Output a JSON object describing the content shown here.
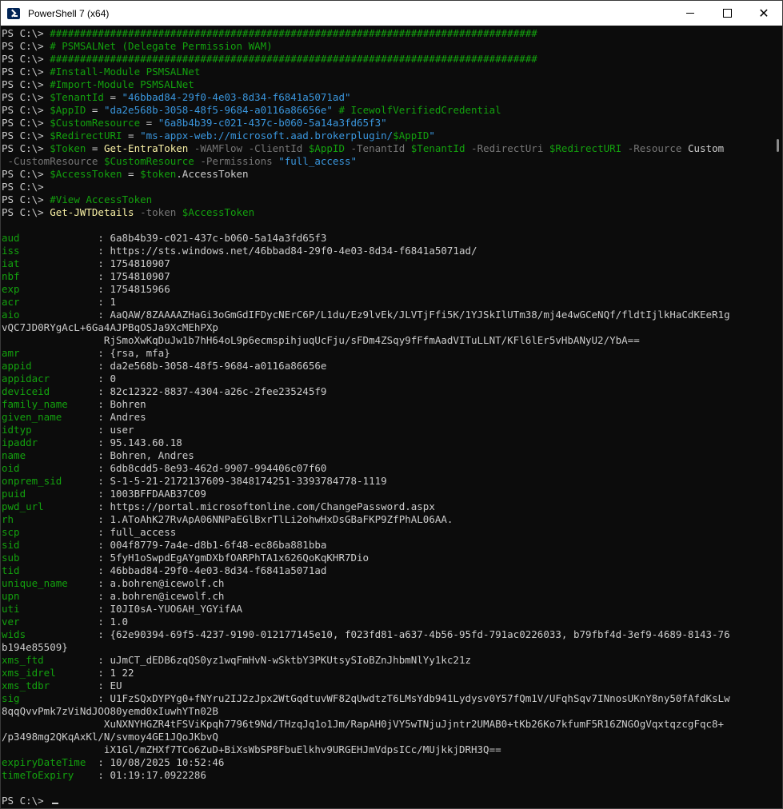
{
  "window": {
    "title": "PowerShell 7 (x64)",
    "minimize_label": "minimize",
    "maximize_label": "maximize",
    "close_label": "close"
  },
  "colors": {
    "background": "#0c0c0c",
    "comment": "#13a10e",
    "string": "#3a96dd",
    "command": "#f9f1a5",
    "parameter": "#767676",
    "key": "#13a10e",
    "text": "#cccccc"
  },
  "console": {
    "lines": [
      [
        {
          "t": "p",
          "x": "PS C:\\> "
        },
        {
          "t": "c",
          "x": "#################################################################################"
        }
      ],
      [
        {
          "t": "p",
          "x": "PS C:\\> "
        },
        {
          "t": "c",
          "x": "# PSMSALNet (Delegate Permission WAM)"
        }
      ],
      [
        {
          "t": "p",
          "x": "PS C:\\> "
        },
        {
          "t": "c",
          "x": "#################################################################################"
        }
      ],
      [
        {
          "t": "p",
          "x": "PS C:\\> "
        },
        {
          "t": "c",
          "x": "#Install-Module PSMSALNet"
        }
      ],
      [
        {
          "t": "p",
          "x": "PS C:\\> "
        },
        {
          "t": "c",
          "x": "#Import-Module PSMSALNet"
        }
      ],
      [
        {
          "t": "p",
          "x": "PS C:\\> "
        },
        {
          "t": "v",
          "x": "$TenantId"
        },
        {
          "t": "t",
          "x": " = "
        },
        {
          "t": "s",
          "x": "\"46bbad84-29f0-4e03-8d34-f6841a5071ad\""
        }
      ],
      [
        {
          "t": "p",
          "x": "PS C:\\> "
        },
        {
          "t": "v",
          "x": "$AppID"
        },
        {
          "t": "t",
          "x": " = "
        },
        {
          "t": "s",
          "x": "\"da2e568b-3058-48f5-9684-a0116a86656e\""
        },
        {
          "t": "t",
          "x": " "
        },
        {
          "t": "c",
          "x": "# IcewolfVerifiedCredential"
        }
      ],
      [
        {
          "t": "p",
          "x": "PS C:\\> "
        },
        {
          "t": "v",
          "x": "$CustomResource"
        },
        {
          "t": "t",
          "x": " = "
        },
        {
          "t": "s",
          "x": "\"6a8b4b39-c021-437c-b060-5a14a3fd65f3\""
        }
      ],
      [
        {
          "t": "p",
          "x": "PS C:\\> "
        },
        {
          "t": "v",
          "x": "$RedirectURI"
        },
        {
          "t": "t",
          "x": " = "
        },
        {
          "t": "s",
          "x": "\"ms-appx-web://microsoft.aad.brokerplugin/"
        },
        {
          "t": "v",
          "x": "$AppID"
        },
        {
          "t": "s",
          "x": "\""
        }
      ],
      [
        {
          "t": "p",
          "x": "PS C:\\> "
        },
        {
          "t": "v",
          "x": "$Token"
        },
        {
          "t": "t",
          "x": " = "
        },
        {
          "t": "cmd",
          "x": "Get-EntraToken"
        },
        {
          "t": "prm",
          "x": " -WAMFlow -ClientId "
        },
        {
          "t": "v",
          "x": "$AppID"
        },
        {
          "t": "prm",
          "x": " -TenantId "
        },
        {
          "t": "v",
          "x": "$TenantId"
        },
        {
          "t": "prm",
          "x": " -RedirectUri "
        },
        {
          "t": "v",
          "x": "$RedirectURI"
        },
        {
          "t": "prm",
          "x": " -Resource "
        },
        {
          "t": "t",
          "x": "Custom"
        }
      ],
      [
        {
          "t": "prm",
          "x": " -CustomResource "
        },
        {
          "t": "v",
          "x": "$CustomResource"
        },
        {
          "t": "prm",
          "x": " -Permissions "
        },
        {
          "t": "s",
          "x": "\"full_access\""
        }
      ],
      [
        {
          "t": "p",
          "x": "PS C:\\> "
        },
        {
          "t": "v",
          "x": "$AccessToken"
        },
        {
          "t": "t",
          "x": " = "
        },
        {
          "t": "v",
          "x": "$token"
        },
        {
          "t": "t",
          "x": ".AccessToken"
        }
      ],
      [
        {
          "t": "p",
          "x": "PS C:\\> "
        }
      ],
      [
        {
          "t": "p",
          "x": "PS C:\\> "
        },
        {
          "t": "c",
          "x": "#View AccessToken"
        }
      ],
      [
        {
          "t": "p",
          "x": "PS C:\\> "
        },
        {
          "t": "cmd",
          "x": "Get-JWTDetails"
        },
        {
          "t": "prm",
          "x": " -token "
        },
        {
          "t": "v",
          "x": "$AccessToken"
        }
      ],
      [],
      [
        {
          "t": "k",
          "x": "aud            "
        },
        {
          "t": "val",
          "x": " : 6a8b4b39-c021-437c-b060-5a14a3fd65f3"
        }
      ],
      [
        {
          "t": "k",
          "x": "iss            "
        },
        {
          "t": "val",
          "x": " : https://sts.windows.net/46bbad84-29f0-4e03-8d34-f6841a5071ad/"
        }
      ],
      [
        {
          "t": "k",
          "x": "iat            "
        },
        {
          "t": "val",
          "x": " : 1754810907"
        }
      ],
      [
        {
          "t": "k",
          "x": "nbf            "
        },
        {
          "t": "val",
          "x": " : 1754810907"
        }
      ],
      [
        {
          "t": "k",
          "x": "exp            "
        },
        {
          "t": "val",
          "x": " : 1754815966"
        }
      ],
      [
        {
          "t": "k",
          "x": "acr            "
        },
        {
          "t": "val",
          "x": " : 1"
        }
      ],
      [
        {
          "t": "k",
          "x": "aio            "
        },
        {
          "t": "val",
          "x": " : AaQAW/8ZAAAAZHaGi3oGmGdIFDycNErC6P/L1du/Ez9lvEk/JLVTjFfi5K/1YJSkIlUTm38/mj4e4wGCeNQf/fldtIjlkHaCdKEeR1g"
        }
      ],
      [
        {
          "t": "val",
          "x": "vQC7JD0RYgAcL+6Ga4AJPBqOSJa9XcMEhPXp"
        }
      ],
      [
        {
          "t": "val",
          "x": "                 RjSmoXwKqDuJw1b7hH64oL9p6ecmspihjuqUcFju/sFDm4ZSqy9fFfmAadVITuLLNT/KFl6lEr5vHbANyU2/YbA=="
        }
      ],
      [
        {
          "t": "k",
          "x": "amr            "
        },
        {
          "t": "val",
          "x": " : {rsa, mfa}"
        }
      ],
      [
        {
          "t": "k",
          "x": "appid          "
        },
        {
          "t": "val",
          "x": " : da2e568b-3058-48f5-9684-a0116a86656e"
        }
      ],
      [
        {
          "t": "k",
          "x": "appidacr       "
        },
        {
          "t": "val",
          "x": " : 0"
        }
      ],
      [
        {
          "t": "k",
          "x": "deviceid       "
        },
        {
          "t": "val",
          "x": " : 82c12322-8837-4304-a26c-2fee235245f9"
        }
      ],
      [
        {
          "t": "k",
          "x": "family_name    "
        },
        {
          "t": "val",
          "x": " : Bohren"
        }
      ],
      [
        {
          "t": "k",
          "x": "given_name     "
        },
        {
          "t": "val",
          "x": " : Andres"
        }
      ],
      [
        {
          "t": "k",
          "x": "idtyp          "
        },
        {
          "t": "val",
          "x": " : user"
        }
      ],
      [
        {
          "t": "k",
          "x": "ipaddr         "
        },
        {
          "t": "val",
          "x": " : 95.143.60.18"
        }
      ],
      [
        {
          "t": "k",
          "x": "name           "
        },
        {
          "t": "val",
          "x": " : Bohren, Andres"
        }
      ],
      [
        {
          "t": "k",
          "x": "oid            "
        },
        {
          "t": "val",
          "x": " : 6db8cdd5-8e93-462d-9907-994406c07f60"
        }
      ],
      [
        {
          "t": "k",
          "x": "onprem_sid     "
        },
        {
          "t": "val",
          "x": " : S-1-5-21-2172137609-3848174251-3393784778-1119"
        }
      ],
      [
        {
          "t": "k",
          "x": "puid           "
        },
        {
          "t": "val",
          "x": " : 1003BFFDAAB37C09"
        }
      ],
      [
        {
          "t": "k",
          "x": "pwd_url        "
        },
        {
          "t": "val",
          "x": " : https://portal.microsoftonline.com/ChangePassword.aspx"
        }
      ],
      [
        {
          "t": "k",
          "x": "rh             "
        },
        {
          "t": "val",
          "x": " : 1.AToAhK27RvApA06NNPaEGlBxrTlLi2ohwHxDsGBaFKP9ZfPhAL06AA."
        }
      ],
      [
        {
          "t": "k",
          "x": "scp            "
        },
        {
          "t": "val",
          "x": " : full_access"
        }
      ],
      [
        {
          "t": "k",
          "x": "sid            "
        },
        {
          "t": "val",
          "x": " : 004f8779-7a4e-d8b1-6f48-ec86ba881bba"
        }
      ],
      [
        {
          "t": "k",
          "x": "sub            "
        },
        {
          "t": "val",
          "x": " : 5fyH1oSwpdEgAYgmDXbfOARPhTA1x626QoKqKHR7Dio"
        }
      ],
      [
        {
          "t": "k",
          "x": "tid            "
        },
        {
          "t": "val",
          "x": " : 46bbad84-29f0-4e03-8d34-f6841a5071ad"
        }
      ],
      [
        {
          "t": "k",
          "x": "unique_name    "
        },
        {
          "t": "val",
          "x": " : a.bohren@icewolf.ch"
        }
      ],
      [
        {
          "t": "k",
          "x": "upn            "
        },
        {
          "t": "val",
          "x": " : a.bohren@icewolf.ch"
        }
      ],
      [
        {
          "t": "k",
          "x": "uti            "
        },
        {
          "t": "val",
          "x": " : I0JI0sA-YUO6AH_YGYifAA"
        }
      ],
      [
        {
          "t": "k",
          "x": "ver            "
        },
        {
          "t": "val",
          "x": " : 1.0"
        }
      ],
      [
        {
          "t": "k",
          "x": "wids           "
        },
        {
          "t": "val",
          "x": " : {62e90394-69f5-4237-9190-012177145e10, f023fd81-a637-4b56-95fd-791ac0226033, b79fbf4d-3ef9-4689-8143-76"
        }
      ],
      [
        {
          "t": "val",
          "x": "b194e85509}"
        }
      ],
      [
        {
          "t": "k",
          "x": "xms_ftd        "
        },
        {
          "t": "val",
          "x": " : uJmCT_dEDB6zqQS0yz1wqFmHvN-wSktbY3PKUtsySIoBZnJhbmNlYy1kc21z"
        }
      ],
      [
        {
          "t": "k",
          "x": "xms_idrel      "
        },
        {
          "t": "val",
          "x": " : 1 22"
        }
      ],
      [
        {
          "t": "k",
          "x": "xms_tdbr       "
        },
        {
          "t": "val",
          "x": " : EU"
        }
      ],
      [
        {
          "t": "k",
          "x": "sig            "
        },
        {
          "t": "val",
          "x": " : U1FzSQxDYPYg0+fNYru2IJ2zJpx2WtGqdtuvWF82qUwdtzT6LMsYdb941Lydysv0Y57fQm1V/UFqhSqv7INnosUKnY8ny50fAfdKsLw"
        }
      ],
      [
        {
          "t": "val",
          "x": "8qqQvvPmk7zViNdJOO80yemd0xIuwhYTn02B"
        }
      ],
      [
        {
          "t": "val",
          "x": "                 XuNXNYHGZR4tFSViKpqh7796t9Nd/THzqJq1o1Jm/RapAH0jVY5wTNjuJjntr2UMAB0+tKb26Ko7kfumF5R16ZNGOgVqxtqzcgFqc8+"
        }
      ],
      [
        {
          "t": "val",
          "x": "/p3498mg2QKqAxKl/N/svmoy4GE1JQoJKbvQ"
        }
      ],
      [
        {
          "t": "val",
          "x": "                 iX1Gl/mZHXf7TCo6ZuD+BiXsWbSP8FbuElkhv9URGEHJmVdpsICc/MUjkkjDRH3Q=="
        }
      ],
      [
        {
          "t": "k",
          "x": "expiryDateTime "
        },
        {
          "t": "val",
          "x": " : 10/08/2025 10:52:46"
        }
      ],
      [
        {
          "t": "k",
          "x": "timeToExpiry   "
        },
        {
          "t": "val",
          "x": " : 01:19:17.0922286"
        }
      ],
      [],
      [
        {
          "t": "p",
          "x": "PS C:\\> "
        },
        {
          "t": "cursor",
          "x": ""
        }
      ]
    ]
  }
}
